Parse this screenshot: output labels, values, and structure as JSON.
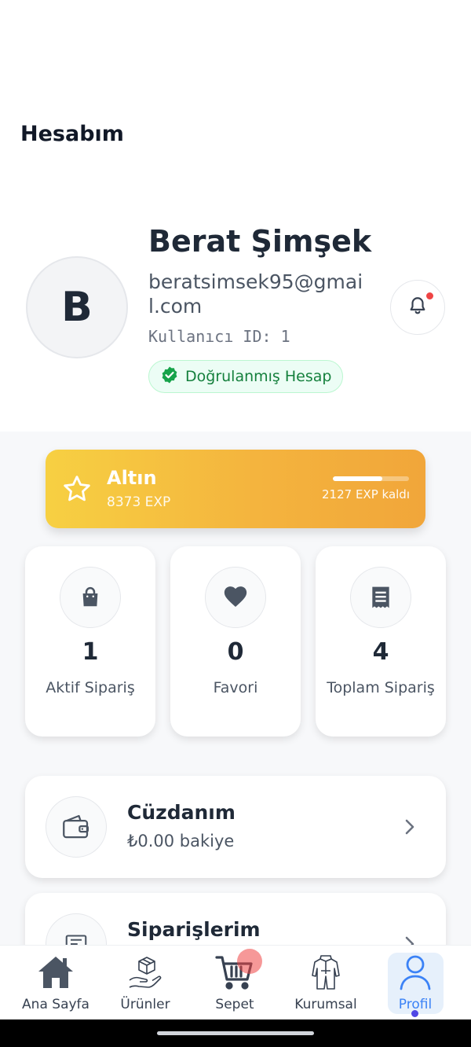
{
  "header": {
    "title": "Hesabım"
  },
  "profile": {
    "avatar_initial": "B",
    "name": "Berat Şimşek",
    "email": "beratsimsek95@gmail.com",
    "user_id": "Kullanıcı ID: 1",
    "verified_label": "Doğrulanmış Hesap",
    "has_notification": true
  },
  "tier": {
    "name": "Altın",
    "exp": "8373 EXP",
    "remaining": "2127 EXP kaldı",
    "progress_fraction": 0.65
  },
  "stats": [
    {
      "icon": "shopping-bag-icon",
      "value": "1",
      "label": "Aktif Sipariş"
    },
    {
      "icon": "heart-icon",
      "value": "0",
      "label": "Favori"
    },
    {
      "icon": "receipt-icon",
      "value": "4",
      "label": "Toplam Sipariş"
    }
  ],
  "menu": [
    {
      "icon": "wallet-icon",
      "title": "Cüzdanım",
      "subtitle": "₺0.00 bakiye"
    },
    {
      "icon": "orders-icon",
      "title": "Siparişlerim",
      "subtitle": ""
    }
  ],
  "nav": [
    {
      "icon": "home-icon",
      "label": "Ana Sayfa",
      "active": false
    },
    {
      "icon": "products-icon",
      "label": "Ürünler",
      "active": false
    },
    {
      "icon": "cart-icon",
      "label": "Sepet",
      "active": false
    },
    {
      "icon": "corporate-icon",
      "label": "Kurumsal",
      "active": false
    },
    {
      "icon": "profile-icon",
      "label": "Profil",
      "active": true
    }
  ],
  "colors": {
    "accent": "#3b82f6",
    "verified_green": "#16a34a",
    "tier_gold_start": "#f7d042",
    "tier_gold_end": "#f1a63a",
    "notification_red": "#ef4444"
  }
}
